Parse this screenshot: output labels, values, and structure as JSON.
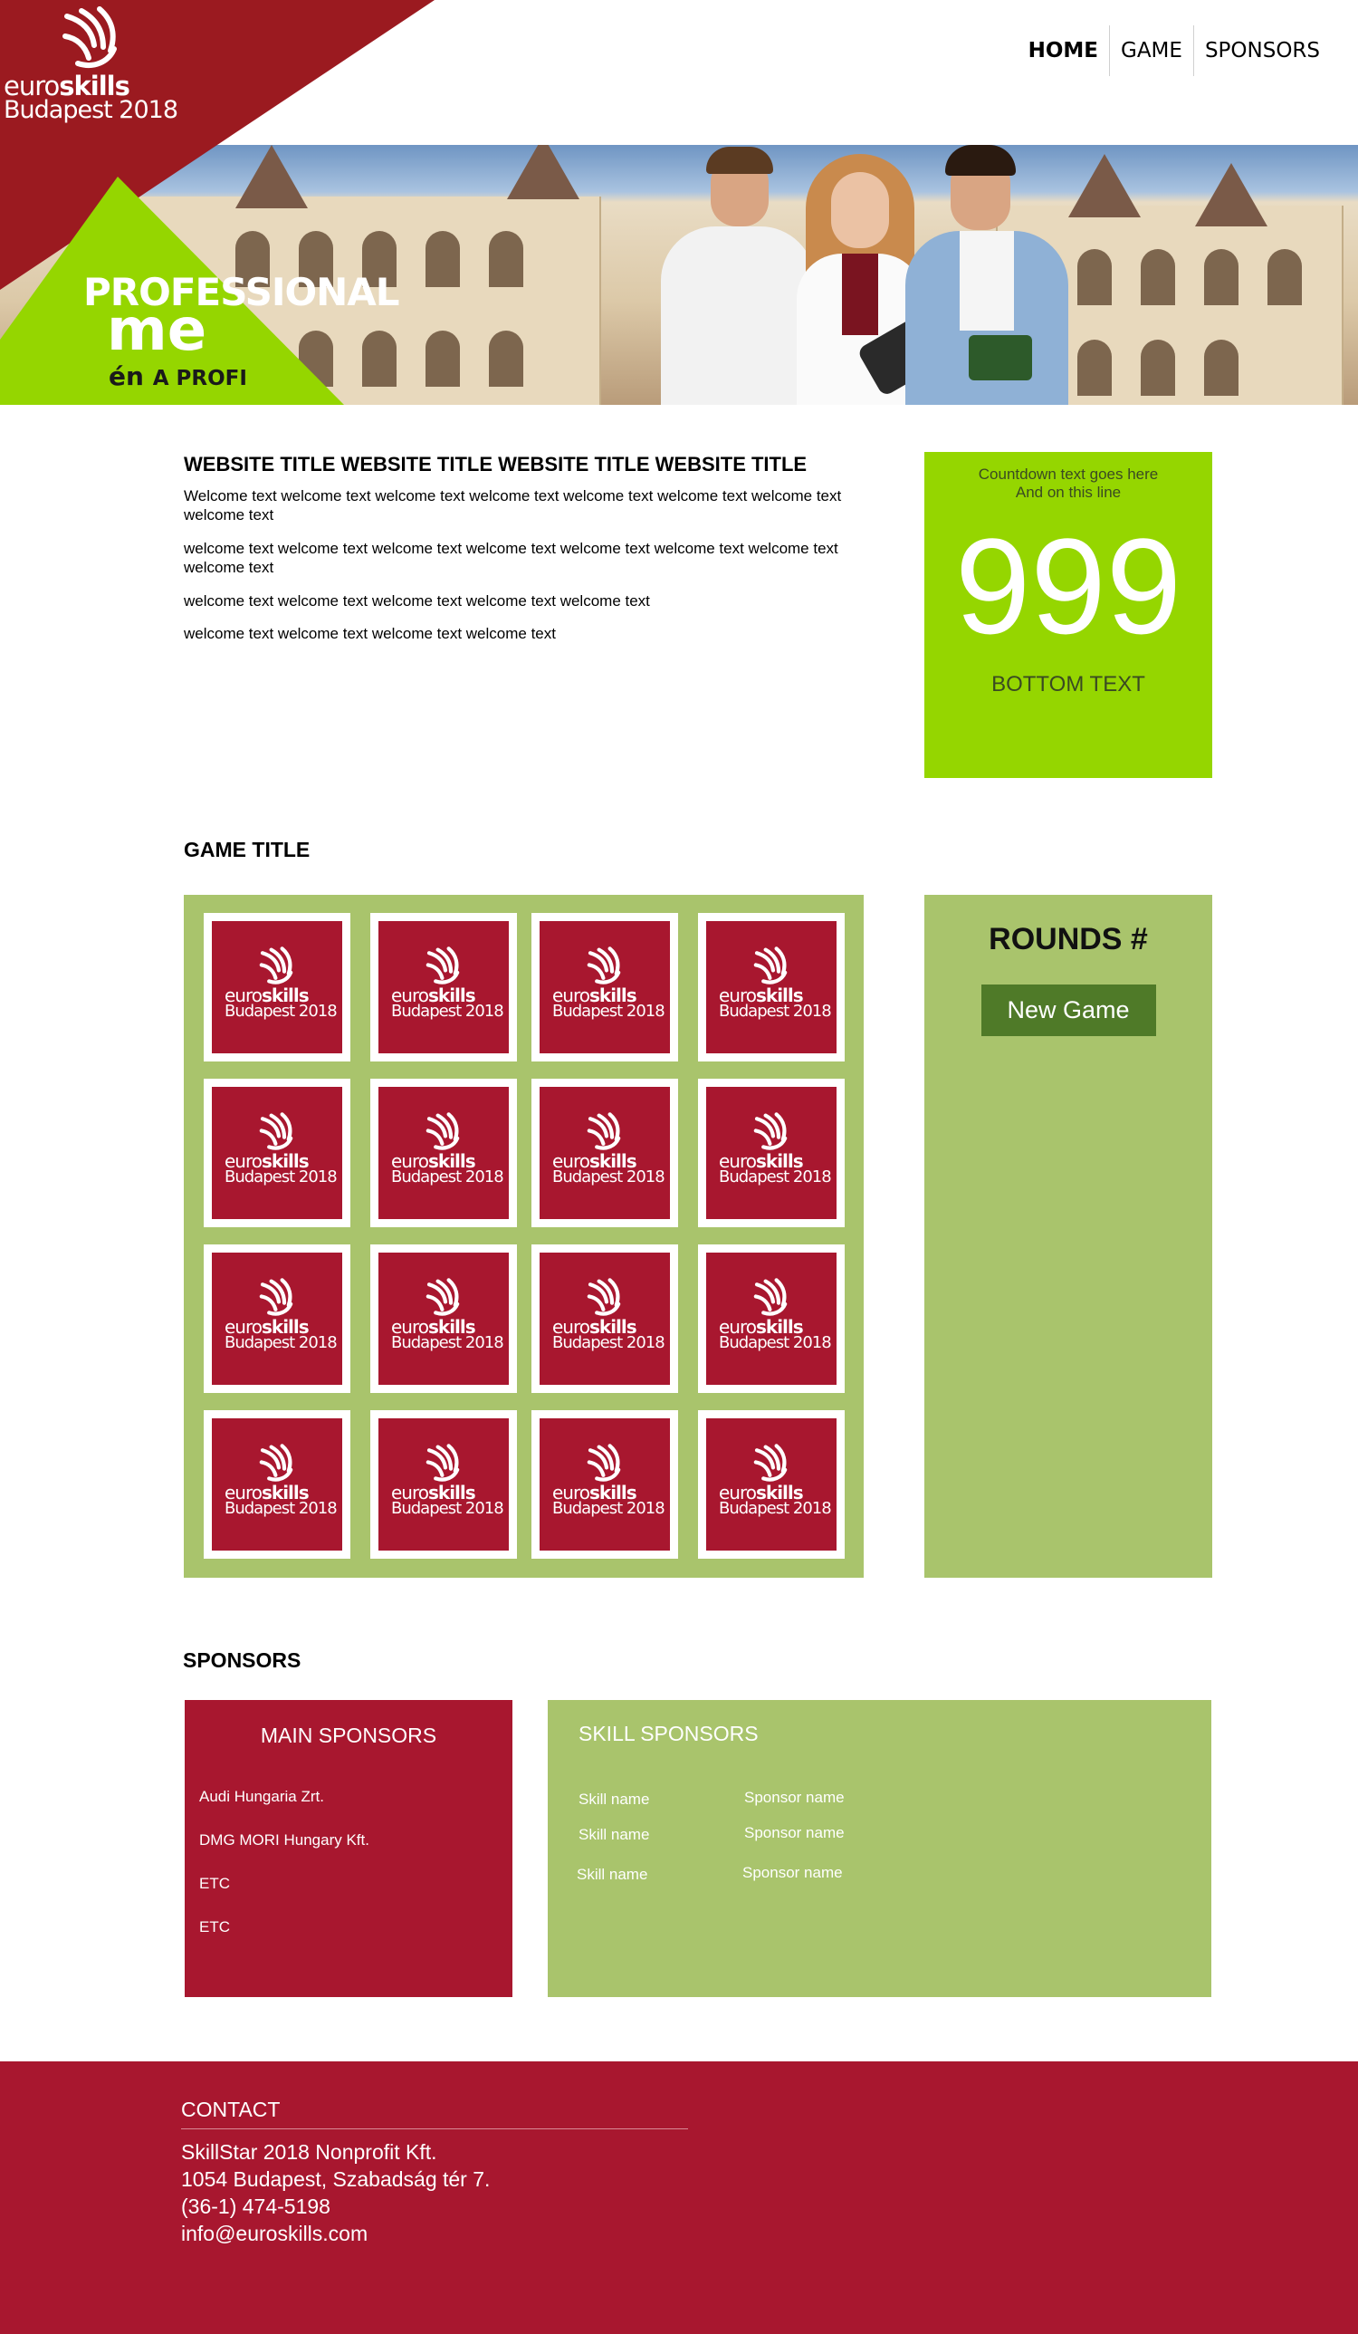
{
  "header": {
    "logo": {
      "brand_light": "euro",
      "brand_bold": "skills",
      "city": "Budapest 2018"
    },
    "nav": [
      {
        "label": "HOME"
      },
      {
        "label": "GAME"
      },
      {
        "label": "SPONSORS"
      }
    ]
  },
  "banner": {
    "headline": "PROFESSIONAL",
    "me": "me",
    "en": "én",
    "aprofi": "A PROFI"
  },
  "welcome": {
    "title": "WEBSITE TITLE WEBSITE TITLE WEBSITE TITLE WEBSITE TITLE",
    "paragraphs": [
      "Welcome text welcome text welcome text welcome text welcome text welcome text welcome text welcome text",
      "welcome text welcome text welcome text welcome text welcome text welcome text welcome text welcome text",
      "welcome text welcome text welcome text welcome text welcome text",
      "welcome text welcome text welcome text welcome text"
    ]
  },
  "countdown": {
    "line1": "Countdown text goes here",
    "line2": "And on this line",
    "number": "999",
    "bottom": "BOTTOM TEXT"
  },
  "game": {
    "title": "GAME TITLE",
    "card_brand_light": "euro",
    "card_brand_bold": "skills",
    "card_city": "Budapest 2018",
    "rounds_label": "ROUNDS #",
    "new_game_label": "New Game"
  },
  "sponsors": {
    "title": "SPONSORS",
    "main": {
      "heading": "MAIN SPONSORS",
      "items": [
        "Audi Hungaria Zrt.",
        "DMG MORI Hungary Kft.",
        "ETC",
        "ETC"
      ]
    },
    "skill": {
      "heading": "SKILL SPONSORS",
      "rows": [
        {
          "skill": "Skill name",
          "sponsor": "Sponsor name"
        },
        {
          "skill": "Skill name",
          "sponsor": "Sponsor name"
        },
        {
          "skill": "Skill name",
          "sponsor": "Sponsor name"
        }
      ]
    }
  },
  "footer": {
    "heading": "CONTACT",
    "lines": [
      "SkillStar 2018 Nonprofit Kft.",
      "1054 Budapest, Szabadság tér 7.",
      "(36-1) 474-5198",
      "info@euroskills.com"
    ]
  },
  "colors": {
    "brand_red": "#a8172f",
    "corner_red": "#9b1a20",
    "lime": "#95d600",
    "olive": "#a9c46c",
    "button_green": "#4f7a28"
  }
}
